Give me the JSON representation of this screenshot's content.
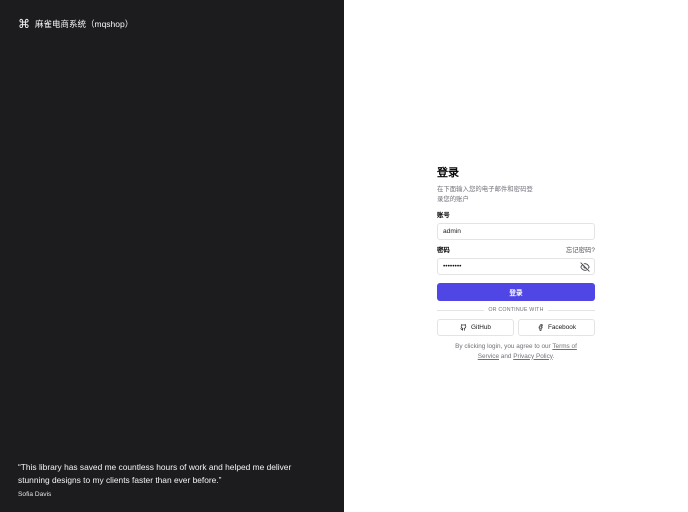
{
  "brand": {
    "icon": "command-icon",
    "name": "麻雀电商系统（mqshop）"
  },
  "testimonial": {
    "quote": "“This library has saved me countless hours of work and helped me deliver stunning designs to my clients faster than ever before.”",
    "author": "Sofia Davis"
  },
  "login": {
    "title": "登录",
    "description": "在下面输入您的电子邮件和密码登录您的账户",
    "account_label": "账号",
    "account_value": "admin",
    "password_label": "密码",
    "forgot_label": "忘记密码?",
    "password_value": "12345678",
    "submit_label": "登录",
    "divider_text": "OR CONTINUE WITH",
    "github_label": "GitHub",
    "facebook_label": "Facebook",
    "terms_prefix": "By clicking login, you agree to our ",
    "terms_link": "Terms of Service",
    "terms_and": " and ",
    "privacy_link": "Privacy Policy",
    "terms_suffix": "."
  },
  "colors": {
    "left_bg": "#1c1b1e",
    "accent": "#4f46e5"
  }
}
